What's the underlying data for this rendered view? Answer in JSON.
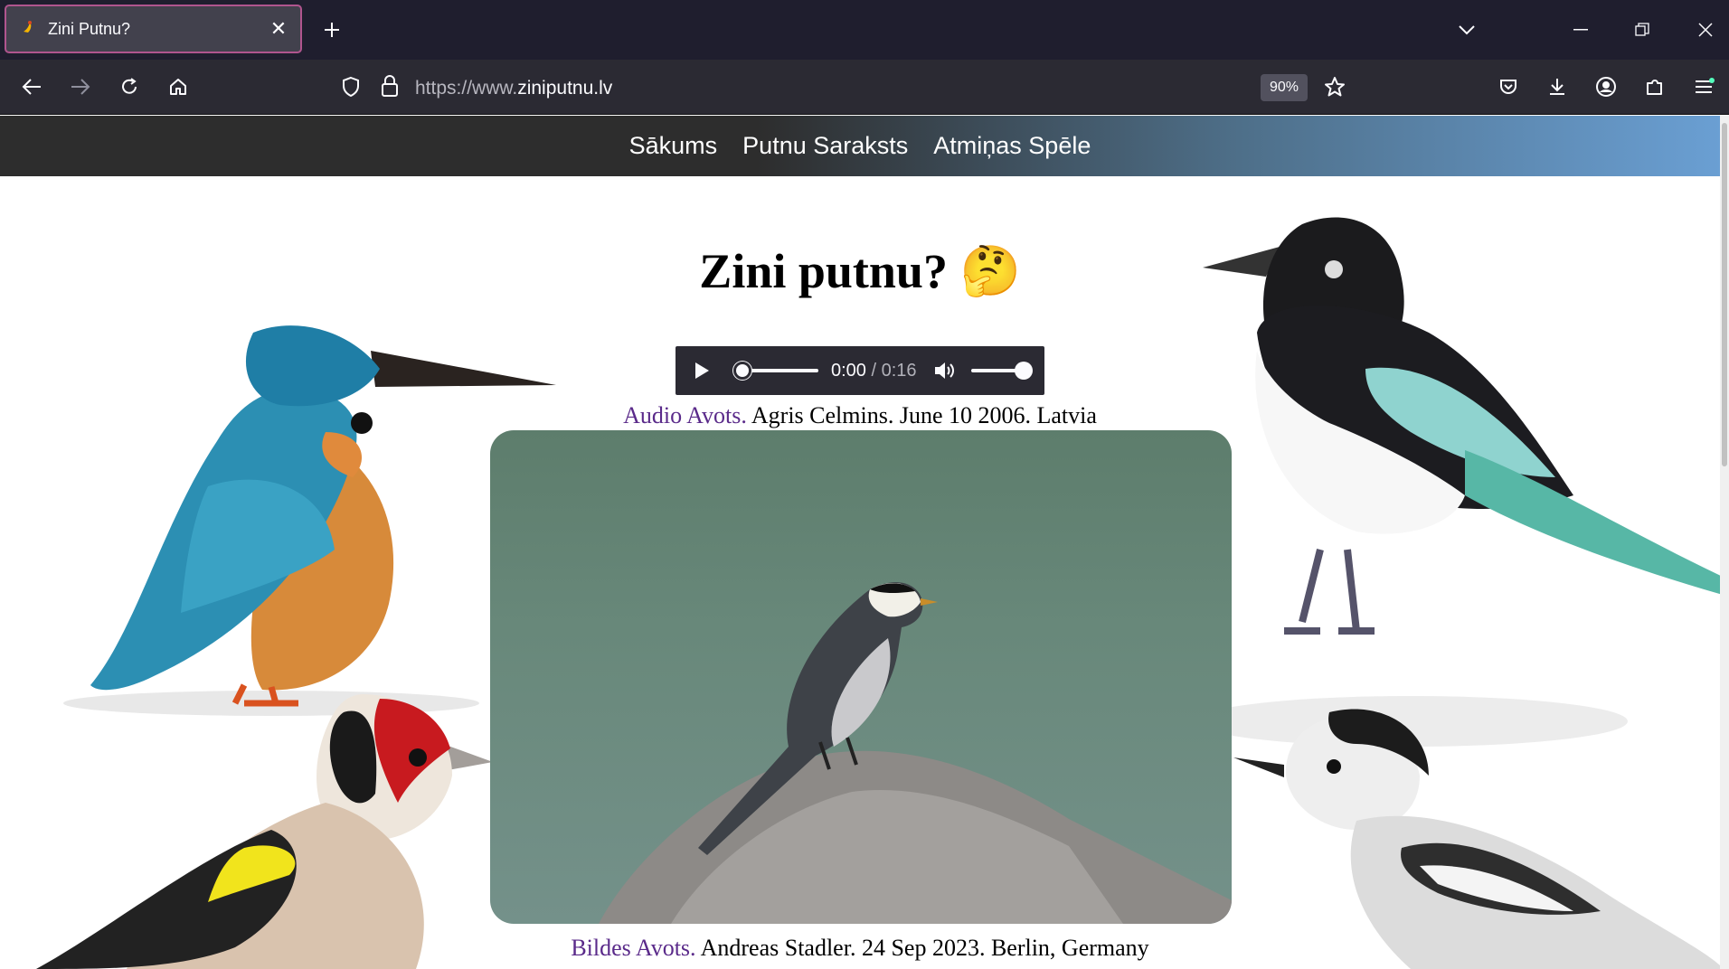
{
  "browser": {
    "tab_title": "Zini Putnu?",
    "url_scheme": "https://www.",
    "url_domain": "ziniputnu.lv",
    "zoom": "90%",
    "accent_color": "#b0558e"
  },
  "site_nav": {
    "items": [
      "Sākums",
      "Putnu Saraksts",
      "Atmiņas Spēle"
    ]
  },
  "page": {
    "title": "Zini putnu? 🤔",
    "audio": {
      "current_time": "0:00",
      "duration": "/ 0:16"
    },
    "audio_credit": {
      "link": "Audio Avots.",
      "text": " Agris Celmins. June 10 2006. Latvia"
    },
    "image_credit": {
      "link": "Bildes Avots.",
      "text": " Andreas Stadler. 24 Sep 2023. Berlin, Germany"
    }
  },
  "icons": {
    "back": "arrow-left-icon",
    "forward": "arrow-right-icon",
    "reload": "reload-icon",
    "home": "home-icon",
    "shield": "shield-icon",
    "lock": "lock-icon",
    "star": "star-icon",
    "pocket": "pocket-icon",
    "download": "download-icon",
    "account": "account-icon",
    "extensions": "puzzle-icon",
    "menu": "hamburger-menu-icon"
  }
}
